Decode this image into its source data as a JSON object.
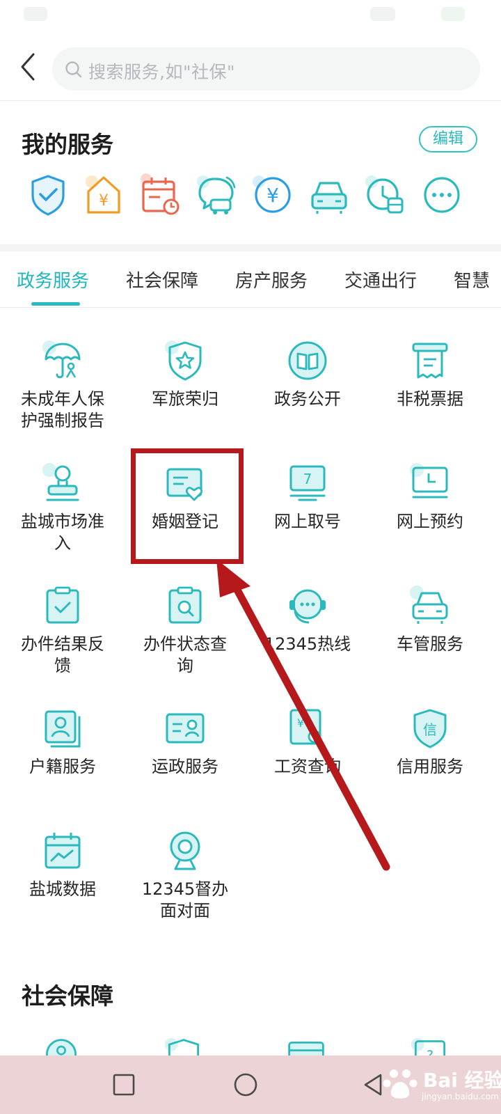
{
  "search": {
    "placeholder": "搜索服务,如\"社保\""
  },
  "my_services": {
    "title": "我的服务",
    "edit_label": "编辑",
    "icons": [
      "shield-check-icon",
      "house-yuan-icon",
      "calendar-clock-icon",
      "chat-car-icon",
      "yuan-circle-icon",
      "car-icon",
      "clock-bus-icon",
      "more-icon"
    ]
  },
  "tabs": [
    "政务服务",
    "社会保障",
    "房产服务",
    "交通出行",
    "智慧"
  ],
  "services": [
    {
      "label": "未成年人保护强制报告",
      "icon": "umbrella-child-icon"
    },
    {
      "label": "军旅荣归",
      "icon": "star-shield-icon"
    },
    {
      "label": "政务公开",
      "icon": "open-book-icon"
    },
    {
      "label": "非税票据",
      "icon": "receipt-icon"
    },
    {
      "label": "盐城市场准入",
      "icon": "stamp-icon"
    },
    {
      "label": "婚姻登记",
      "icon": "marriage-card-icon"
    },
    {
      "label": "网上取号",
      "icon": "queue-number-icon"
    },
    {
      "label": "网上预约",
      "icon": "monitor-appointment-icon"
    },
    {
      "label": "办件结果反馈",
      "icon": "clipboard-check-icon"
    },
    {
      "label": "办件状态查询",
      "icon": "clipboard-search-icon"
    },
    {
      "label": "12345热线",
      "icon": "headset-icon"
    },
    {
      "label": "车管服务",
      "icon": "car-icon"
    },
    {
      "label": "户籍服务",
      "icon": "person-card-icon"
    },
    {
      "label": "运政服务",
      "icon": "id-card-icon"
    },
    {
      "label": "工资查询",
      "icon": "salary-search-icon"
    },
    {
      "label": "信用服务",
      "icon": "credit-shield-icon"
    },
    {
      "label": "盐城数据",
      "icon": "calendar-chart-icon"
    },
    {
      "label": "12345督办面对面",
      "icon": "webcam-icon"
    }
  ],
  "section2": {
    "title": "社会保障"
  },
  "watermark": {
    "brand": "Bai 经验",
    "url": "jingyan.baidu.com"
  },
  "colors": {
    "accent": "#2ab9bc",
    "highlight": "#b6191b",
    "nav_bg": "#ebd3d6"
  }
}
